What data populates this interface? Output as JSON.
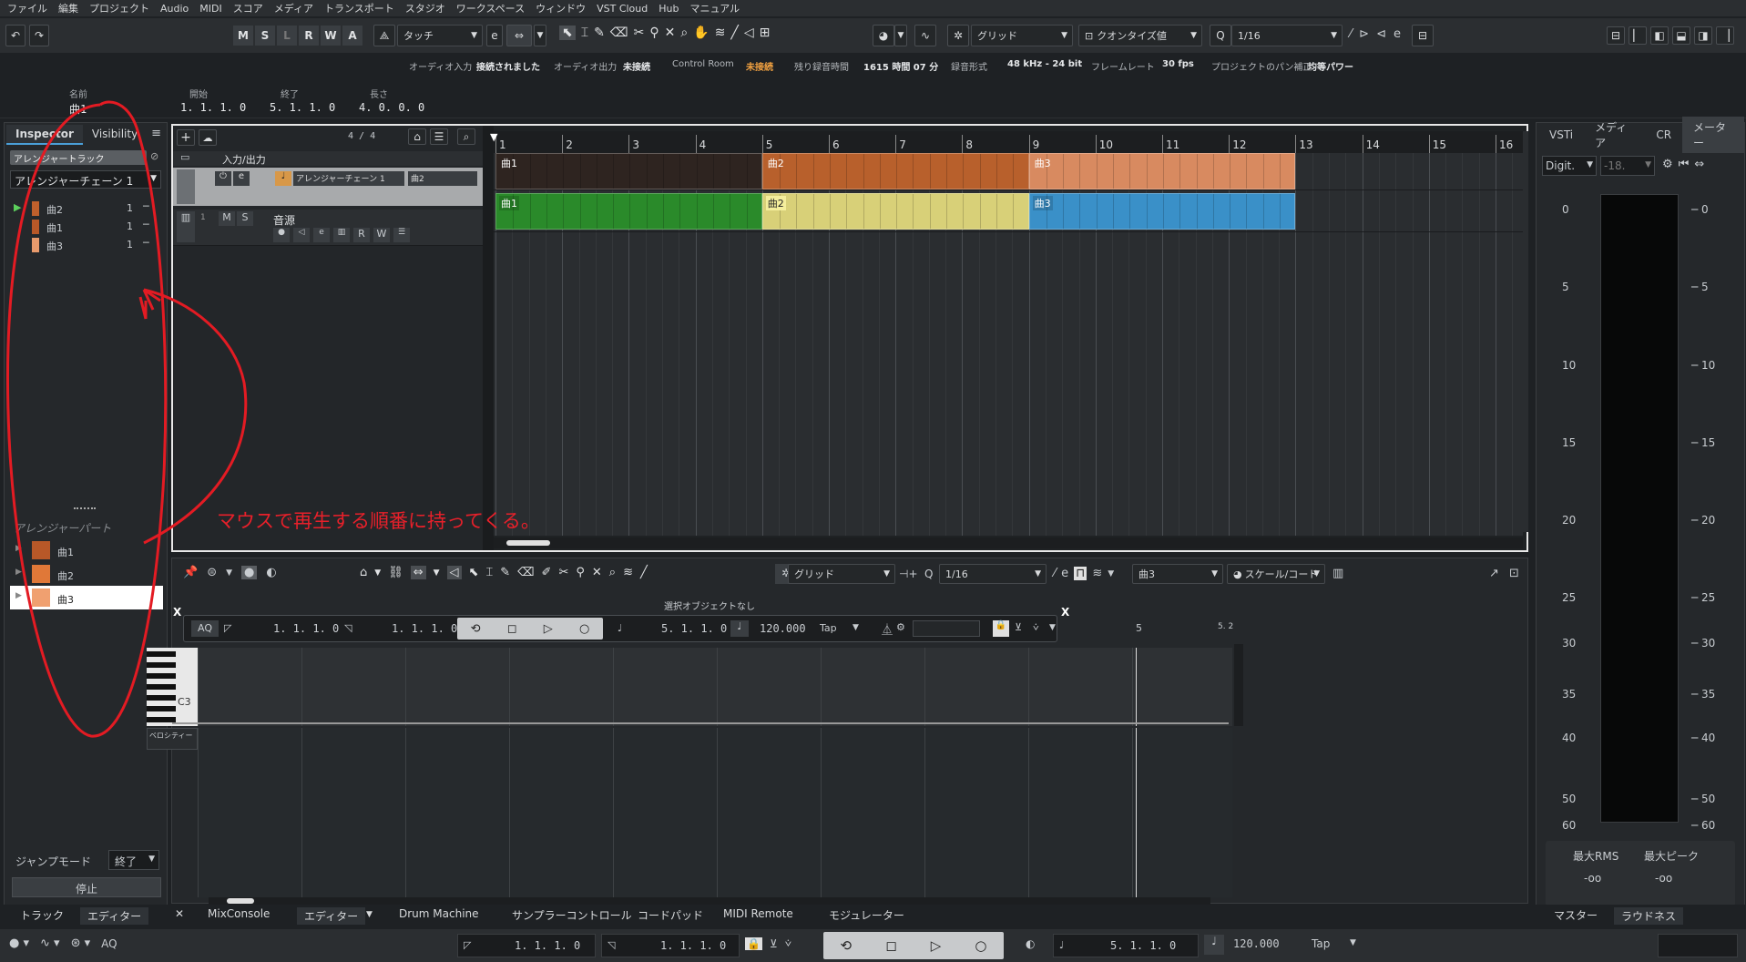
{
  "menu": [
    "ファイル",
    "編集",
    "プロジェクト",
    "Audio",
    "MIDI",
    "スコア",
    "メディア",
    "トランスポート",
    "スタジオ",
    "ワークスペース",
    "ウィンドウ",
    "VST Cloud",
    "Hub",
    "マニュアル"
  ],
  "toolbar": {
    "msrlwa": [
      "M",
      "S",
      "L",
      "R",
      "W",
      "A"
    ],
    "automation_mode": "タッチ",
    "snap_type": "グリッド",
    "quantize_mode": "クオンタイズ値",
    "quantize_value": "1/16"
  },
  "status": {
    "audio_in_label": "オーディオ入力",
    "audio_in_value": "接続されました",
    "audio_out_label": "オーディオ出力",
    "audio_out_value": "未接続",
    "control_room_label": "Control Room",
    "control_room_value": "未接続",
    "remaining_label": "残り録音時間",
    "remaining_value": "1615 時間 07 分",
    "format_label": "録音形式",
    "format_value": "48 kHz - 24 bit",
    "framerate_label": "フレームレート",
    "framerate_value": "30 fps",
    "pan_label": "プロジェクトのパン補正",
    "pan_value": "均等パワー"
  },
  "infoline": {
    "name_label": "名前",
    "name_value": "曲1",
    "start_label": "開始",
    "start_value": "1. 1. 1.   0",
    "end_label": "終了",
    "end_value": "5. 1. 1.   0",
    "length_label": "長さ",
    "length_value": "4. 0. 0.   0"
  },
  "inspector": {
    "tab_inspector": "Inspector",
    "tab_visibility": "Visibility",
    "track_name": "アレンジャートラック",
    "chain": "アレンジャーチェーン 1",
    "chain_items": [
      {
        "name": "曲2",
        "count": "1",
        "color": "#c0602c"
      },
      {
        "name": "曲1",
        "count": "1",
        "color": "#b85828"
      },
      {
        "name": "曲3",
        "count": "1",
        "color": "#e89a6c"
      }
    ],
    "parts_label": "アレンジャーパート",
    "parts": [
      {
        "name": "曲1",
        "color": "#b85828"
      },
      {
        "name": "曲2",
        "color": "#e07838"
      },
      {
        "name": "曲3",
        "color": "#f0a070"
      }
    ],
    "jump_label": "ジャンプモード",
    "jump_value": "終了",
    "stop_label": "停止"
  },
  "annotation": "マウスで再生する順番に持ってくる。",
  "project": {
    "time_sig": "4 / 4",
    "track1_name": "入力/出力",
    "track1_sel1": "アレンジャーチェーン 1",
    "track1_sel2": "曲2",
    "track2_num": "1",
    "track2_name": "音源",
    "ruler_ticks": [
      "1",
      "2",
      "3",
      "4",
      "5",
      "6",
      "7",
      "8",
      "9",
      "10",
      "11",
      "12",
      "13",
      "14",
      "15",
      "16"
    ],
    "arranger_parts": [
      {
        "name": "曲1",
        "start": 1,
        "end": 5,
        "color": "#2e2420"
      },
      {
        "name": "曲2",
        "start": 5,
        "end": 9,
        "color": "#b8602c"
      },
      {
        "name": "曲3",
        "start": 9,
        "end": 13,
        "color": "#d88a60"
      }
    ],
    "midi_parts": [
      {
        "name": "曲1",
        "start": 1,
        "end": 5,
        "color": "#2a8a2a"
      },
      {
        "name": "曲2",
        "start": 5,
        "end": 9,
        "color": "#d8d078"
      },
      {
        "name": "曲3",
        "start": 9,
        "end": 13,
        "color": "#3a90c8"
      }
    ]
  },
  "editor": {
    "snap": "グリッド",
    "quantize": "1/16",
    "part_name": "曲3",
    "scale": "スケール/コード",
    "no_selection": "選択オブジェクトなし",
    "aq": "AQ",
    "left_locator": "1. 1. 1.   0",
    "right_locator": "1. 1. 1.   0",
    "position": "5. 1. 1.   0",
    "tempo": "120.000",
    "tap": "Tap",
    "key_c3": "C3",
    "velocity": "ベロシティー",
    "ruler_5": "5",
    "ruler_52": "5. 2"
  },
  "right": {
    "tabs": [
      "VSTi",
      "メディア",
      "CR",
      "メーター"
    ],
    "meter_type": "Digit.",
    "meter_val": "-18.",
    "scale": [
      "0",
      "5",
      "10",
      "15",
      "20",
      "25",
      "30",
      "35",
      "40",
      "50",
      "60"
    ],
    "rms_label": "最大RMS",
    "peak_label": "最大ピーク",
    "rms_value": "-oo",
    "peak_value": "-oo",
    "tab_master": "マスター",
    "tab_loudness": "ラウドネス"
  },
  "bottomtabs": {
    "track": "トラック",
    "editor": "エディター",
    "mixconsole": "MixConsole",
    "editor2": "エディター",
    "drum": "Drum Machine",
    "sampler": "サンプラーコントロール",
    "chordpad": "コードパッド",
    "midiremote": "MIDI Remote",
    "modulator": "モジュレーター"
  },
  "transport": {
    "aq": "AQ",
    "left": "1. 1. 1.   0",
    "right": "1. 1. 1.   0",
    "position": "5. 1. 1.   0",
    "tempo": "120.000",
    "tap": "Tap"
  }
}
